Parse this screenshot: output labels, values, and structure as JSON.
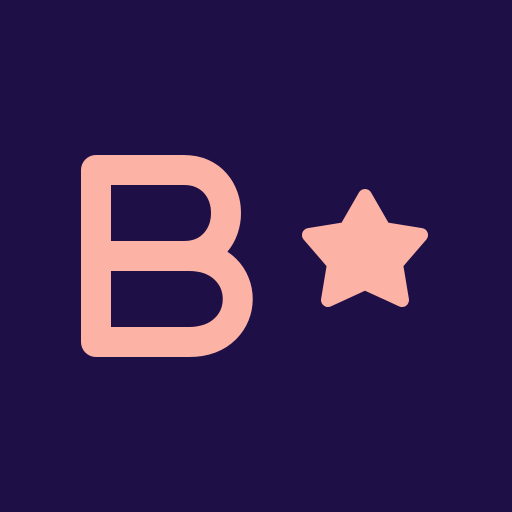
{
  "logo": {
    "letter": "B",
    "icon": "star-icon"
  },
  "colors": {
    "background": "#1f0f47",
    "accent": "#fcb2a4"
  }
}
